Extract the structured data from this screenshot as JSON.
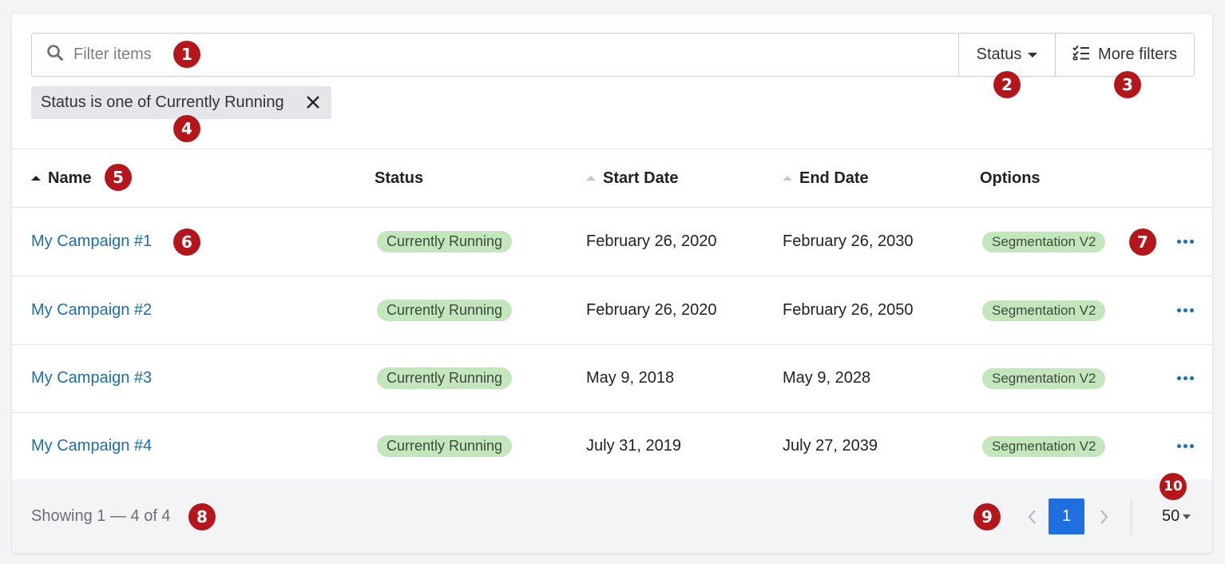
{
  "filter": {
    "placeholder": "Filter items",
    "status_label": "Status",
    "more_filters_label": "More filters",
    "active_chip": "Status is one of Currently Running"
  },
  "columns": {
    "name": "Name",
    "status": "Status",
    "start_date": "Start Date",
    "end_date": "End Date",
    "options": "Options"
  },
  "rows": [
    {
      "name": "My Campaign #1",
      "status": "Currently Running",
      "start": "February 26, 2020",
      "end": "February 26, 2030",
      "option": "Segmentation V2"
    },
    {
      "name": "My Campaign #2",
      "status": "Currently Running",
      "start": "February 26, 2020",
      "end": "February 26, 2050",
      "option": "Segmentation V2"
    },
    {
      "name": "My Campaign #3",
      "status": "Currently Running",
      "start": "May 9, 2018",
      "end": "May 9, 2028",
      "option": "Segmentation V2"
    },
    {
      "name": "My Campaign #4",
      "status": "Currently Running",
      "start": "July 31, 2019",
      "end": "July 27, 2039",
      "option": "Segmentation V2"
    }
  ],
  "footer": {
    "showing": "Showing 1 — 4 of 4",
    "current_page": "1",
    "per_page": "50"
  },
  "markers": [
    "1",
    "2",
    "3",
    "4",
    "5",
    "6",
    "7",
    "8",
    "9",
    "10"
  ],
  "colors": {
    "marker": "#b4161b",
    "link": "#1a6fb3",
    "badge": "#c3e6bd",
    "page_active": "#1f6fe0"
  }
}
